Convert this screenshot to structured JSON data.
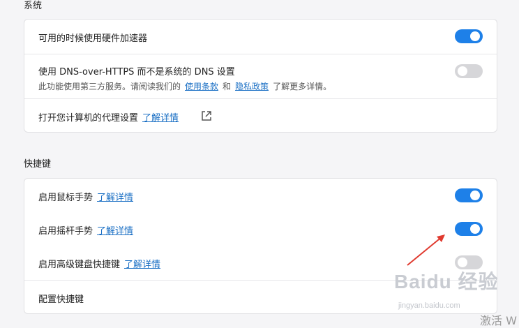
{
  "system": {
    "title": "系统",
    "hw_accel": {
      "label": "可用的时候使用硬件加速器",
      "enabled": true
    },
    "dns": {
      "label": "使用 DNS-over-HTTPS 而不是系统的 DNS 设置",
      "desc_prefix": "此功能使用第三方服务。请阅读我们的",
      "terms_link": "使用条款",
      "and_text": "和",
      "privacy_link": "隐私政策",
      "desc_suffix": "了解更多详情。",
      "enabled": false
    },
    "proxy": {
      "label": "打开您计算机的代理设置",
      "link": "了解详情"
    }
  },
  "shortcuts": {
    "title": "快捷键",
    "mouse_gestures": {
      "label": "启用鼠标手势",
      "link": "了解详情",
      "enabled": true
    },
    "rocker_gestures": {
      "label": "启用摇杆手势",
      "link": "了解详情",
      "enabled": true
    },
    "advanced_keyboard": {
      "label": "启用高级键盘快捷键",
      "link": "了解详情",
      "enabled": false
    },
    "configure": {
      "label": "配置快捷键"
    }
  },
  "overlay": {
    "watermark_brand": "Baidu 经验",
    "watermark_url": "jingyan.baidu.com",
    "activate_text": "激活 W"
  },
  "colors": {
    "accent": "#1e80e8",
    "link": "#1a6fc4",
    "annotation_arrow": "#e03a2f"
  }
}
